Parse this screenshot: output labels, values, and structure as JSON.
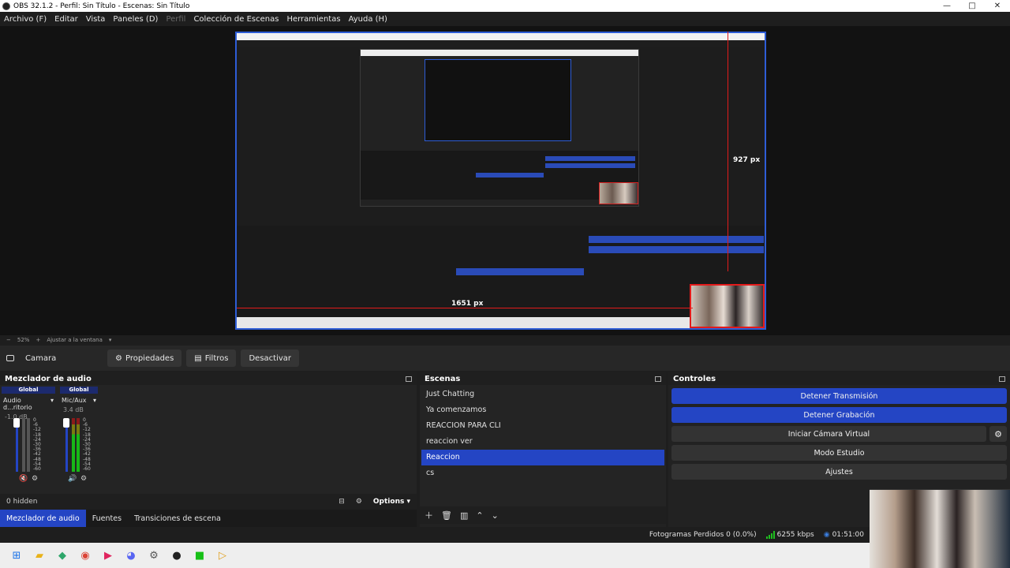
{
  "window": {
    "title": "OBS 32.1.2 - Perfil: Sin Título - Escenas: Sin Título",
    "controls": [
      "—",
      "□",
      "✕"
    ]
  },
  "menu": [
    {
      "label": "Archivo (F)",
      "disabled": false
    },
    {
      "label": "Editar",
      "disabled": false
    },
    {
      "label": "Vista",
      "disabled": false
    },
    {
      "label": "Paneles (D)",
      "disabled": false
    },
    {
      "label": "Perfil",
      "disabled": true
    },
    {
      "label": "Colección de Escenas",
      "disabled": false
    },
    {
      "label": "Herramientas",
      "disabled": false
    },
    {
      "label": "Ayuda (H)",
      "disabled": false
    }
  ],
  "preview": {
    "measure_vertical": "927 px",
    "measure_horizontal": "1651 px",
    "zoom": "52%",
    "fit_label": "Ajustar a la ventana"
  },
  "source_bar": {
    "source_name": "Camara",
    "properties": "Propiedades",
    "filters": "Filtros",
    "deactivate": "Desactivar"
  },
  "mixer": {
    "title": "Mezclador de audio",
    "channels": [
      {
        "global": "Global",
        "name": "Audio d...ritorio",
        "db": "-1.0 dB",
        "active": false,
        "muted": true
      },
      {
        "global": "Global",
        "name": "Mic/Aux",
        "db": "3.4 dB",
        "active": true,
        "muted": false
      }
    ],
    "scale": [
      "0",
      "-6",
      "-12",
      "-18",
      "-24",
      "-30",
      "-36",
      "-42",
      "-48",
      "-54",
      "-60"
    ],
    "hidden": "0 hidden",
    "options": "Options",
    "tabs": [
      {
        "label": "Mezclador de audio",
        "active": true
      },
      {
        "label": "Fuentes",
        "active": false
      },
      {
        "label": "Transiciones de escena",
        "active": false
      }
    ]
  },
  "scenes": {
    "title": "Escenas",
    "items": [
      {
        "label": "Just Chatting",
        "selected": false
      },
      {
        "label": "Ya comenzamos",
        "selected": false
      },
      {
        "label": "REACCION PARA CLI",
        "selected": false
      },
      {
        "label": "reaccion ver",
        "selected": false
      },
      {
        "label": "Reaccion",
        "selected": true
      },
      {
        "label": "cs",
        "selected": false
      }
    ]
  },
  "controls": {
    "title": "Controles",
    "stop_stream": "Detener Transmisión",
    "stop_recording": "Detener Grabación",
    "virtual_camera": "Iniciar Cámara Virtual",
    "studio_mode": "Modo Estudio",
    "settings": "Ajustes"
  },
  "status": {
    "dropped_frames": "Fotogramas Perdidos 0 (0.0%)",
    "bitrate": "6255 kbps",
    "stream_time": "01:51:00"
  },
  "colors": {
    "accent": "#2445c4",
    "selection_border": "#e31b1b",
    "background": "#1e1e1e"
  },
  "taskbar_icons": [
    "windows-icon",
    "file-explorer-icon",
    "app-icon",
    "chrome-icon",
    "media-icon",
    "discord-icon",
    "settings-icon",
    "obs-icon",
    "green-app-icon",
    "player-icon"
  ]
}
